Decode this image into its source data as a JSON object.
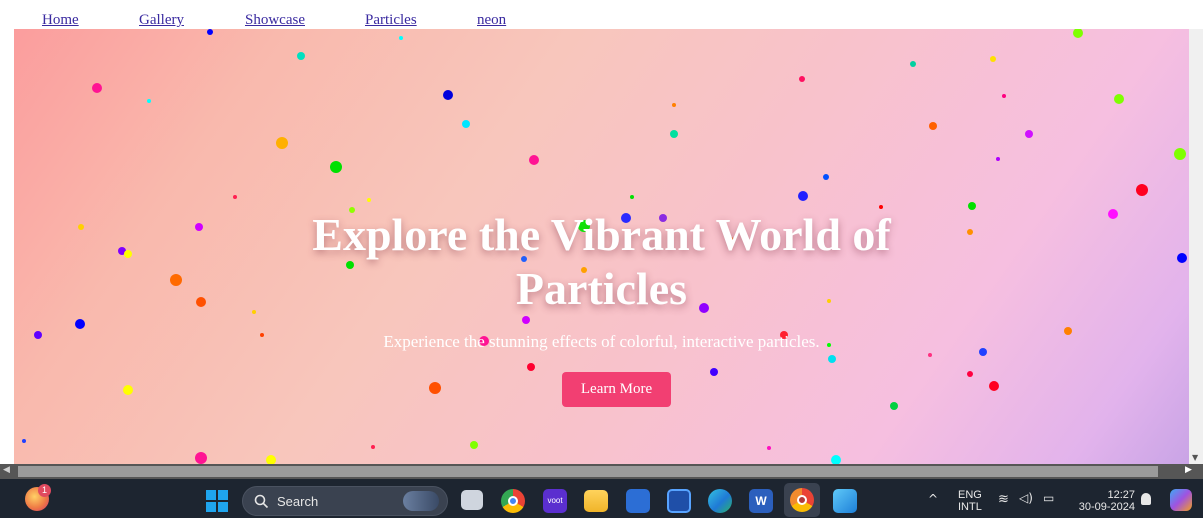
{
  "nav": {
    "items": [
      {
        "label": "Home"
      },
      {
        "label": "Gallery"
      },
      {
        "label": "Showcase"
      },
      {
        "label": "Particles"
      },
      {
        "label": "neon"
      }
    ]
  },
  "hero": {
    "title_line1": "Explore the Vibrant World of",
    "title_line2": "Particles",
    "subtitle": "Experience the stunning effects of colorful, interactive particles.",
    "cta_label": "Learn More"
  },
  "colors": {
    "cta": "#f23f72",
    "nav_link": "#3a2aa0",
    "taskbar": "#1d2530",
    "particle_palette": [
      "#ff00ff",
      "#00ffff",
      "#ffff00",
      "#ff0000",
      "#00ff00",
      "#0000ff",
      "#ff7f00",
      "#ff1493",
      "#8a2be2",
      "#7fff00"
    ]
  },
  "taskbar": {
    "search_label": "Search",
    "notification_badge": "1",
    "language": "ENG",
    "keyboard": "INTL",
    "time": "12:27",
    "date": "30-09-2024",
    "icons": [
      "copilot-icon",
      "windows-start-icon",
      "search-icon",
      "widgets-icon",
      "task-view-icon",
      "chrome-icon",
      "voot-icon",
      "file-explorer-icon",
      "store-icon",
      "app-icon",
      "edge-icon",
      "word-icon",
      "chrome-active-icon",
      "photos-icon"
    ]
  }
}
